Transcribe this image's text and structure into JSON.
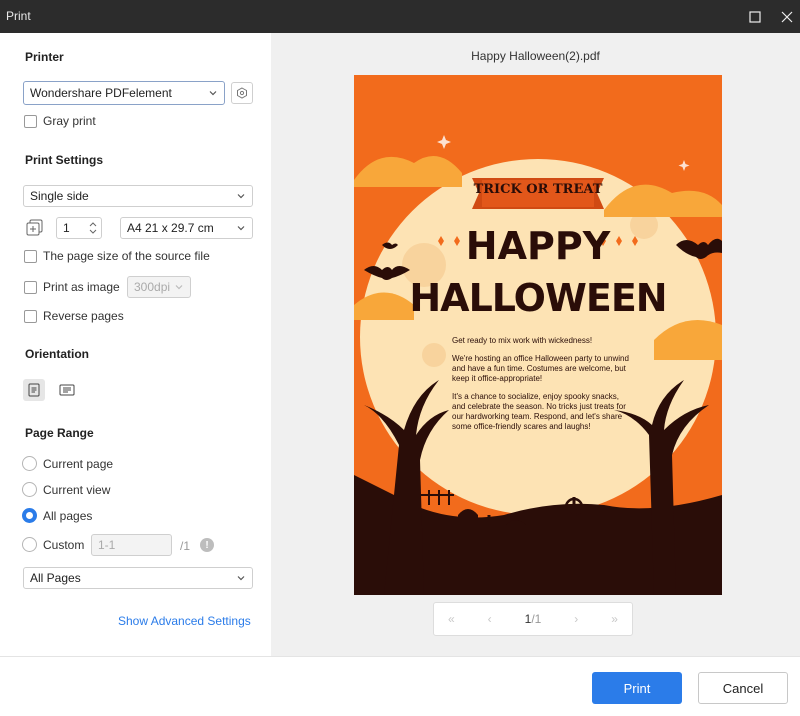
{
  "window": {
    "title": "Print"
  },
  "printer": {
    "section_label": "Printer",
    "selected": "Wondershare PDFelement",
    "gray_print_label": "Gray print"
  },
  "print_settings": {
    "section_label": "Print Settings",
    "side": "Single side",
    "copies": "1",
    "paper": "A4 21 x 29.7 cm",
    "page_size_source_label": "The page size of the source file",
    "print_as_image_label": "Print as image",
    "dpi": "300dpi",
    "reverse_pages_label": "Reverse pages"
  },
  "orientation": {
    "section_label": "Orientation"
  },
  "page_range": {
    "section_label": "Page Range",
    "current_page": "Current page",
    "current_view": "Current view",
    "all_pages": "All pages",
    "custom": "Custom",
    "custom_placeholder": "1-1",
    "custom_total": "/1",
    "subset": "All Pages"
  },
  "advanced_link": "Show Advanced Settings",
  "preview": {
    "file_name": "Happy Halloween(2).pdf",
    "page_indicator": "1",
    "page_total": "/1",
    "poster": {
      "banner": "TRICK OR TREAT",
      "headline1": "HAPPY",
      "headline2": "HALLOWEEN",
      "p1": "Get ready to mix work with wickedness!",
      "p2": "We're hosting an office Halloween party to unwind and have a fun time. Costumes are welcome, but keep it office-appropriate!",
      "p3": "It's a chance to socialize, enjoy spooky snacks, and celebrate the season. No tricks just treats for our hardworking team. Respond, and let's share some office-friendly scares and laughs!"
    }
  },
  "footer": {
    "print_label": "Print",
    "cancel_label": "Cancel"
  },
  "colors": {
    "accent": "#2b7ce9",
    "poster_orange": "#f06a1a",
    "moon": "#fde3b4",
    "silhouette": "#2a0d08"
  }
}
